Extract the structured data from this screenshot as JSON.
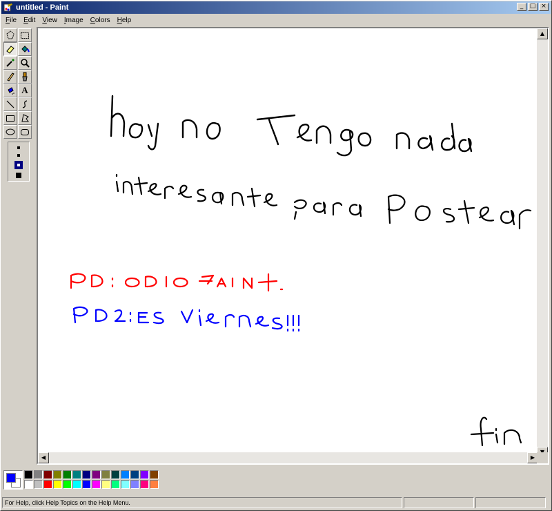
{
  "window": {
    "title": "untitled - Paint"
  },
  "menu": [
    {
      "first": "F",
      "rest": "ile"
    },
    {
      "first": "E",
      "rest": "dit"
    },
    {
      "first": "V",
      "rest": "iew"
    },
    {
      "first": "I",
      "rest": "mage"
    },
    {
      "first": "C",
      "rest": "olors"
    },
    {
      "first": "H",
      "rest": "elp"
    }
  ],
  "toolbox": {
    "tools": [
      "free-select",
      "rect-select",
      "eraser",
      "fill",
      "picker",
      "magnifier",
      "pencil",
      "brush",
      "airbrush",
      "text",
      "line",
      "curve",
      "rectangle",
      "polygon",
      "ellipse",
      "rounded-rect"
    ],
    "text_tool_label": "A"
  },
  "canvas": {
    "line1": "hoy no Tengo nada",
    "line2": "interesante para Postear",
    "pd1": "PD: ODIO PAINT.",
    "pd2": "PD2: ES VIERNES!!!",
    "end": "fin",
    "pd1_color": "#ff0000",
    "pd2_color": "#0000ff",
    "ink_color": "#000000"
  },
  "palette": {
    "foreground": "#0000ff",
    "background": "#ffffff",
    "colors": [
      "#000000",
      "#808080",
      "#800000",
      "#808000",
      "#008000",
      "#008080",
      "#000080",
      "#800080",
      "#808040",
      "#004040",
      "#0080ff",
      "#004080",
      "#8000ff",
      "#804000",
      "#ffffff",
      "#c0c0c0",
      "#ff0000",
      "#ffff00",
      "#00ff00",
      "#00ffff",
      "#0000ff",
      "#ff00ff",
      "#ffff80",
      "#00ff80",
      "#80ffff",
      "#8080ff",
      "#ff0080",
      "#ff8040"
    ]
  },
  "status": {
    "help_text": "For Help, click Help Topics on the Help Menu."
  }
}
